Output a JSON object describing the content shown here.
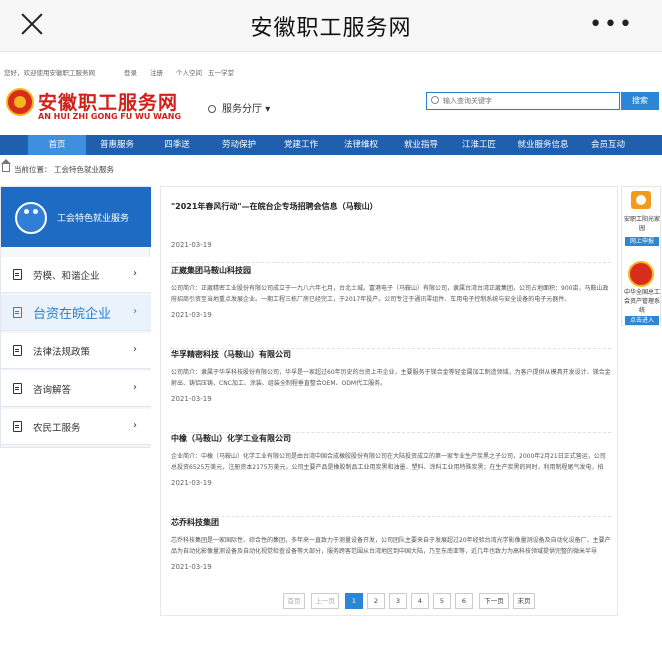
{
  "topbar": {
    "title": "安徽职工服务网"
  },
  "toplinks": {
    "welcome": "您好，欢迎使用安徽职工服务网",
    "links": [
      "登录",
      "注册",
      "个人空间",
      "五一学堂"
    ]
  },
  "header": {
    "logo_cn": "安徽职工服务网",
    "logo_en": "AN HUI ZHI GONG FU WU WANG",
    "service_hall": "服务分厅",
    "search_placeholder": "输入查询关键字",
    "search_button": "搜索"
  },
  "nav": [
    "首页",
    "普惠服务",
    "四季送",
    "劳动保护",
    "党建工作",
    "法律维权",
    "就业指导",
    "江淮工匠",
    "就业服务信息",
    "会员互动"
  ],
  "breadcrumb": {
    "label": "当前位置：",
    "value": "工会特色就业服务"
  },
  "sidebar": {
    "header": "工会特色就业服务",
    "items": [
      "劳模、和谐企业",
      "台资在皖企业",
      "法律法规政策",
      "咨询解答",
      "农民工服务"
    ]
  },
  "articles": [
    {
      "title": "\"2021年春风行动\"—在皖台企专场招聘会信息（马鞍山）",
      "desc": "",
      "date": "2021-03-19"
    },
    {
      "title": "正崴集团马鞍山科技园",
      "desc": "公司简介：正崴精密工业股份有限公司成立于一九八六年七月，台北土城。富港电子（马鞍山）有限公司，隶属台湾台湾正崴集团，公司占地面积：900亩，马鞍山政府招商引资至当地重点发展企业。一期工程三栋厂房已经完工，于2017年投产。公司专注于通讯零组件、车用电子控制系统与安全设备的电子元器件。",
      "date": "2021-03-19"
    },
    {
      "title": "华孚精密科技（马鞍山）有限公司",
      "desc": "公司简介：隶属于华孚科技股份有限公司，华孚是一家超过60年历史的台资上市企业，主要服务于镁合金等轻金属加工制造领域，为客户提供从模具开发设计、镁合金射出、铸铝压铸、CNC加工、涂装、组装全制程垂直整合OEM、ODM代工服务。",
      "date": "2021-03-19"
    },
    {
      "title": "中橡（马鞍山）化学工业有限公司",
      "desc": "企业简介：中橡（马鞍山）化学工业有限公司是由台湾中国合成橡胶股份有限公司在大陆投资成立的第一家专业生产炭黑之子公司，2000年2月21日正式营运，公司总投资6525万美元，注册资本2175万美元，公司主要产品是橡胶制品工业用炭黑和油墨、塑料、涂料工业用特殊炭黑；在生产炭黑的同时，利用制程尾气发电，拍",
      "date": "2021-03-19"
    },
    {
      "title": "芯乔科技集团",
      "desc": "芯乔科技集团是一家国际性、综合性的集团，多年来一直致力于测量设备开发，公司团队主要来自于发展超过20年经验台湾光学影像量测设备及自动化设备厂，主要产品为自动化影像量测设备及自动化视觉检查设备等大部分，服务跨客范围从台湾地区到中国大陆，乃至东南亚等，近几年也致力为高科技领域提供完整的微米半导",
      "date": "2021-03-19"
    }
  ],
  "pagination": {
    "first": "首页",
    "prev": "上一页",
    "pages": [
      "1",
      "2",
      "3",
      "4",
      "5",
      "6"
    ],
    "current": "1",
    "next": "下一页",
    "last": "末页"
  },
  "right_widgets": {
    "a_text": "安职工阳光家园",
    "a_button": "网上申报",
    "b_text": "中华全国总工会资产管理系统",
    "b_button": "点击进入"
  },
  "colors": {
    "brand_red": "#d0201a",
    "nav_blue": "#1f5fae",
    "accent_blue": "#2b86d6"
  }
}
